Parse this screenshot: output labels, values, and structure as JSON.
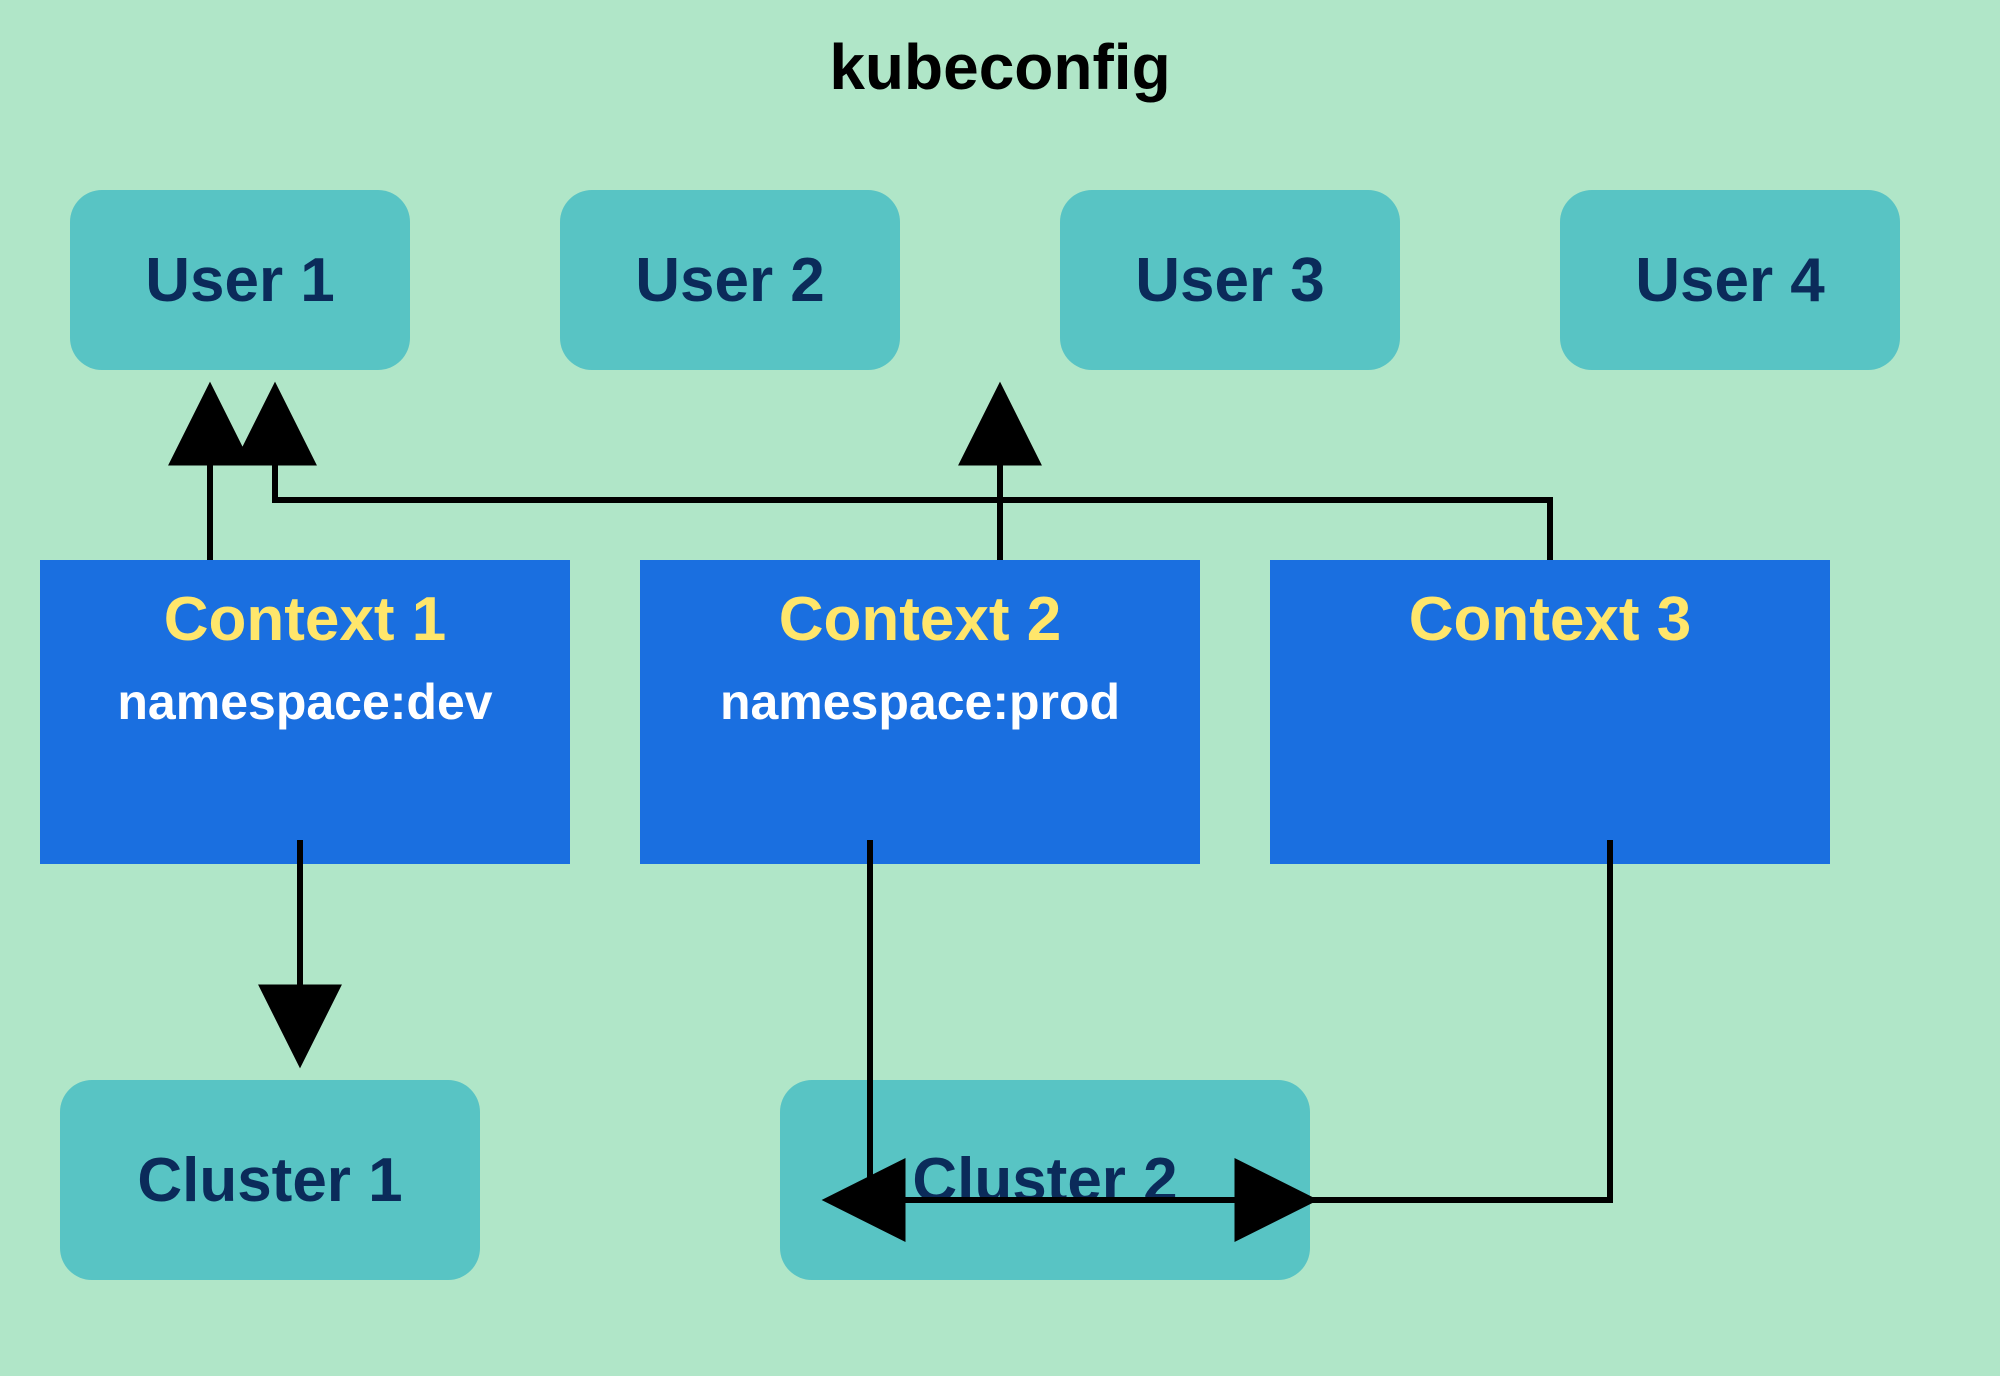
{
  "title": "kubeconfig",
  "users": [
    {
      "label": "User 1"
    },
    {
      "label": "User 2"
    },
    {
      "label": "User 3"
    },
    {
      "label": "User 4"
    }
  ],
  "contexts": [
    {
      "title": "Context 1",
      "namespace": "namespace:dev",
      "user": "User 1",
      "cluster": "Cluster 1"
    },
    {
      "title": "Context 2",
      "namespace": "namespace:prod",
      "user": "User 3",
      "cluster": "Cluster 2"
    },
    {
      "title": "Context 3",
      "namespace": "",
      "user": "User 1",
      "cluster": "Cluster 2"
    }
  ],
  "clusters": [
    {
      "label": "Cluster 1"
    },
    {
      "label": "Cluster 2"
    }
  ]
}
